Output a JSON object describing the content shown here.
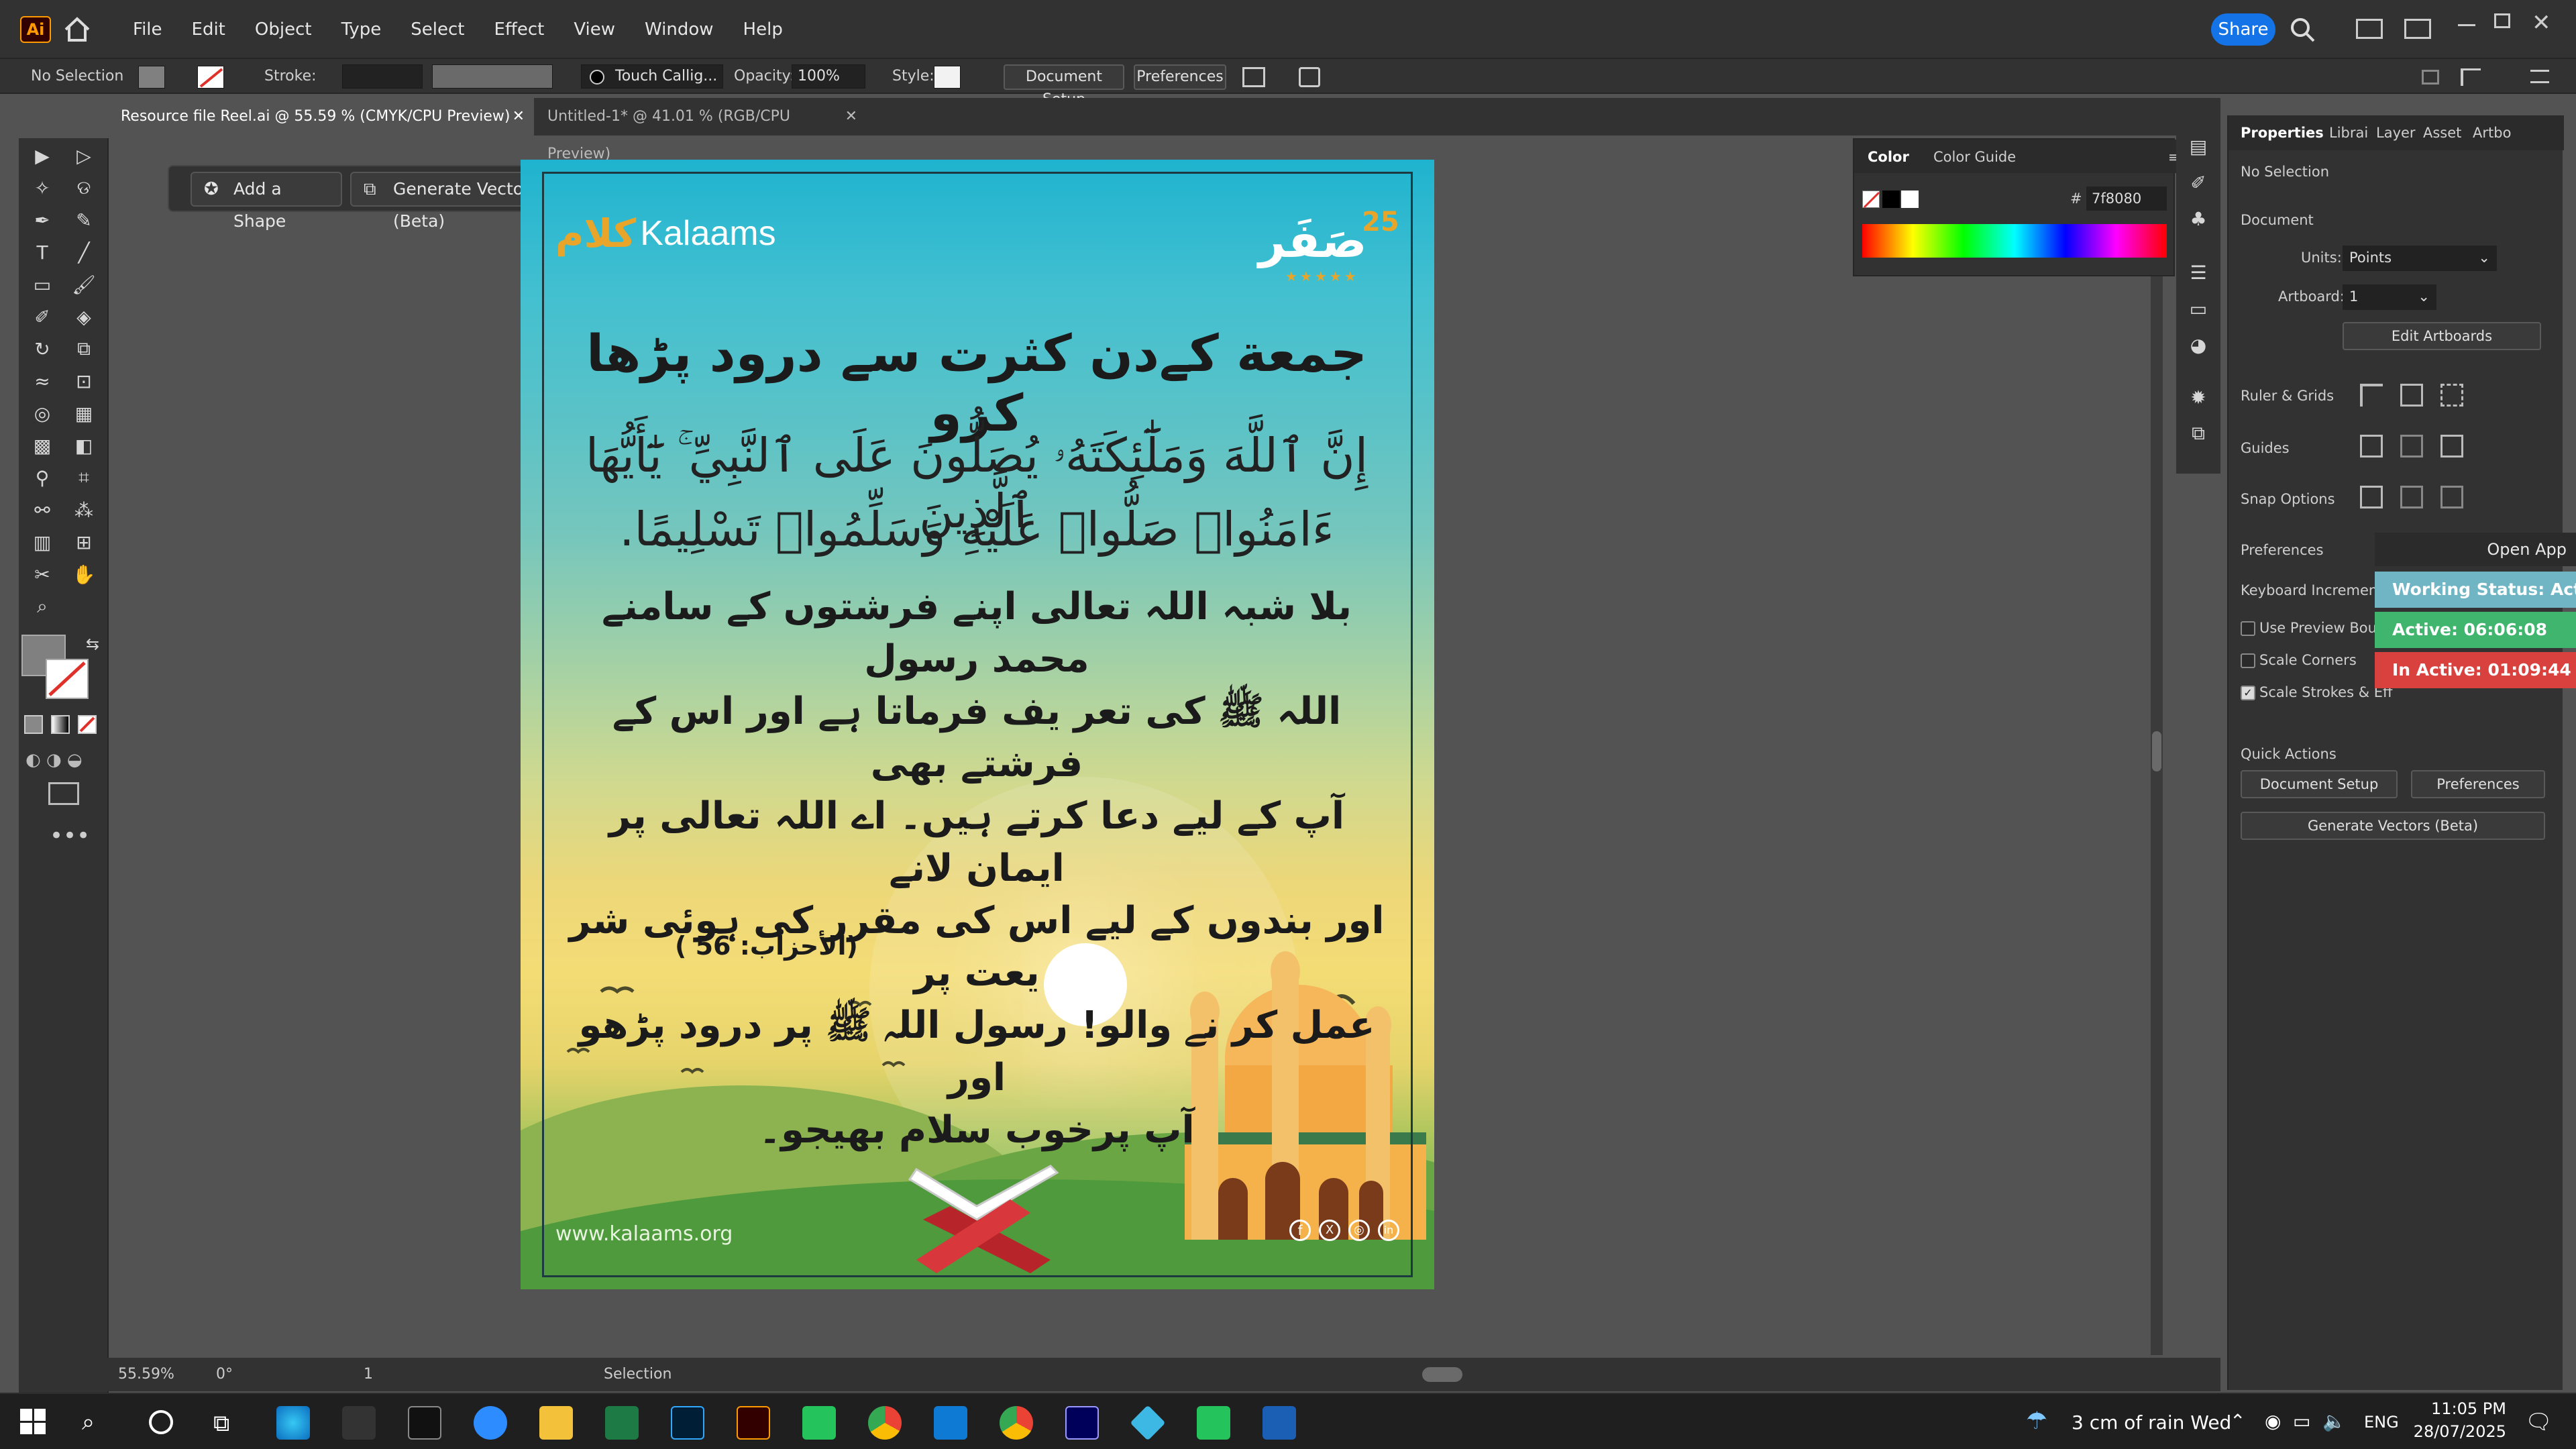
{
  "app": {
    "logo": "Ai",
    "menus": [
      "File",
      "Edit",
      "Object",
      "Type",
      "Select",
      "Effect",
      "View",
      "Window",
      "Help"
    ],
    "share_label": "Share"
  },
  "control_bar": {
    "selection": "No Selection",
    "stroke_label": "Stroke:",
    "brush": "Touch Callig...",
    "opacity_label": "Opacity:",
    "opacity_value": "100%",
    "style_label": "Style:",
    "document_setup": "Document Setup",
    "preferences": "Preferences"
  },
  "tabs": [
    {
      "label": "Resource file Reel.ai @ 55.59 % (CMYK/CPU Preview)",
      "active": true
    },
    {
      "label": "Untitled-1* @ 41.01 % (RGB/CPU Preview)",
      "active": false
    }
  ],
  "context_bar": {
    "add_shape": "Add a Shape",
    "generate_vectors": "Generate Vectors (Beta)"
  },
  "artwork": {
    "brand": "Kalaams",
    "brand_arabic": "كلام",
    "badge_arabic": "صَفَر",
    "badge_number": "25",
    "heading": "جمعة کےدن کثرت سے درود پڑھا کرو",
    "quran_line1": "إِنَّ ٱللَّهَ وَمَلَٰٓئِكَتَهُۥ يُصَلُّونَ عَلَى ٱلنَّبِيِّ ۚ يَٰٓأَيُّهَا ٱلَّذِينَ",
    "quran_line2": "ءَامَنُوا۟ صَلُّوا۟ عَلَيْهِ وَسَلِّمُوا۟ تَسْلِيمًا.",
    "translation": [
      "بلا شبہ اللہ تعالی اپنے فرشتوں کے سامنے محمد رسول",
      "اللہ ﷺ کی تعر یف فرماتا ہے اور اس کے فرشتے بھی",
      "آپ کے لیے دعا کرتے ہیں۔ اے اللہ تعالی پر ایمان لانے",
      "اور بندوں کے لیے اس کی مقرر کی ہوئی شر یعت پر",
      "عمل کر نے والو! رسول اللہ ﷺ پر درود پڑھو اور",
      "آپ پرخوب سلام بھیجو۔"
    ],
    "reference": "(الأحزاب: 56 )",
    "website": "www.kalaams.org",
    "social_icons": [
      "facebook-icon",
      "x-icon",
      "instagram-icon",
      "linkedin-icon"
    ]
  },
  "color_panel": {
    "tabs": [
      "Color",
      "Color Guide"
    ],
    "hex_label": "#",
    "hex_value": "7f8080"
  },
  "properties": {
    "tabs": [
      "Properties",
      "Librai",
      "Layer",
      "Asset",
      "Artbo"
    ],
    "selection": "No Selection",
    "document_label": "Document",
    "units_label": "Units:",
    "units_value": "Points",
    "artboard_label": "Artboard:",
    "artboard_value": "1",
    "edit_artboards": "Edit Artboards",
    "ruler_grids": "Ruler & Grids",
    "guides": "Guides",
    "snap_options": "Snap Options",
    "preferences_label": "Preferences",
    "keyboard_increment": "Keyboard Increment:",
    "use_preview": "Use Preview Bound",
    "scale_corners": "Scale Corners",
    "scale_strokes": "Scale Strokes & Eff",
    "quick_actions": "Quick Actions",
    "qa_document_setup": "Document Setup",
    "qa_preferences": "Preferences",
    "qa_generate_vectors": "Generate Vectors (Beta)"
  },
  "overlay": {
    "open_app": "Open App",
    "working_status": "Working Status: Active",
    "active": "Active: 06:06:08",
    "inactive": "In Active: 01:09:44",
    "colors": {
      "working": "#6fb5c4",
      "active": "#3fb56d",
      "inactive": "#d9413f"
    }
  },
  "status_bar": {
    "zoom": "55.59%",
    "rotation": "0°",
    "artboard": "1",
    "tool": "Selection"
  },
  "taskbar": {
    "weather": "3 cm of rain Wed",
    "lang": "ENG",
    "time": "11:05 PM",
    "date": "28/07/2025"
  }
}
